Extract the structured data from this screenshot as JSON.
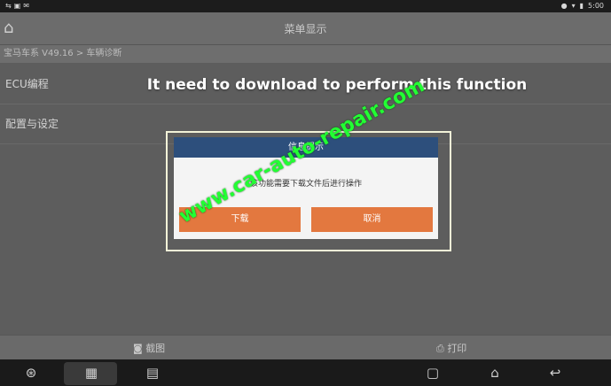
{
  "status_bar": {
    "left_icons": [
      "usb-icon",
      "image-icon",
      "mail-icon"
    ],
    "time": "5:00"
  },
  "header": {
    "title": "菜单显示"
  },
  "path": {
    "text": "宝马车系 V49.16 > 车辆诊断"
  },
  "menu": {
    "items": [
      {
        "label": "ECU编程"
      },
      {
        "label": "配置与设定"
      }
    ]
  },
  "caption": "It need to download to perform this function",
  "dialog": {
    "title": "信息提示",
    "message": "该功能需要下载文件后进行操作",
    "buttons": [
      {
        "label": "下载"
      },
      {
        "label": "取消"
      }
    ]
  },
  "watermark": "www.car-auto-repair.com",
  "bottom_actions": [
    {
      "label": "截图",
      "icon": "camera-icon"
    },
    {
      "label": "打印",
      "icon": "print-icon"
    }
  ],
  "nav_icons": [
    "steering-wheel-icon",
    "screenshot-icon",
    "vci-icon",
    "recent-apps-icon",
    "home-icon",
    "back-icon"
  ]
}
